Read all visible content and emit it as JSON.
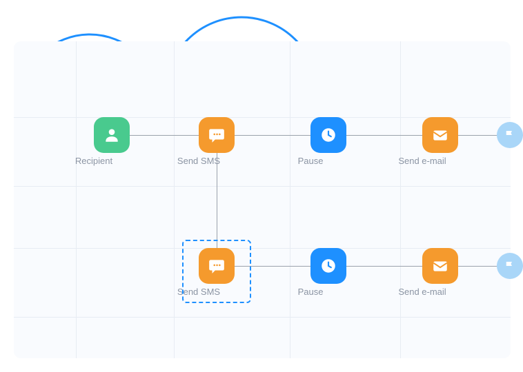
{
  "nodes": {
    "recipient": {
      "label": "Recipient",
      "color": "#49ca8e",
      "icon": "person"
    },
    "sms1": {
      "label": "Send SMS",
      "color": "#f59a2d",
      "icon": "sms"
    },
    "pause1": {
      "label": "Pause",
      "color": "#1e90ff",
      "icon": "clock"
    },
    "email1": {
      "label": "Send e-mail",
      "color": "#f59a2d",
      "icon": "mail"
    },
    "sms2": {
      "label": "Send SMS",
      "color": "#f59a2d",
      "icon": "sms"
    },
    "pause2": {
      "label": "Pause",
      "color": "#1e90ff",
      "icon": "clock"
    },
    "email2": {
      "label": "Send e-mail",
      "color": "#f59a2d",
      "icon": "mail"
    }
  },
  "flags": {
    "flag1": {
      "icon": "flag"
    },
    "flag2": {
      "icon": "flag"
    }
  },
  "selected_node": "sms2"
}
